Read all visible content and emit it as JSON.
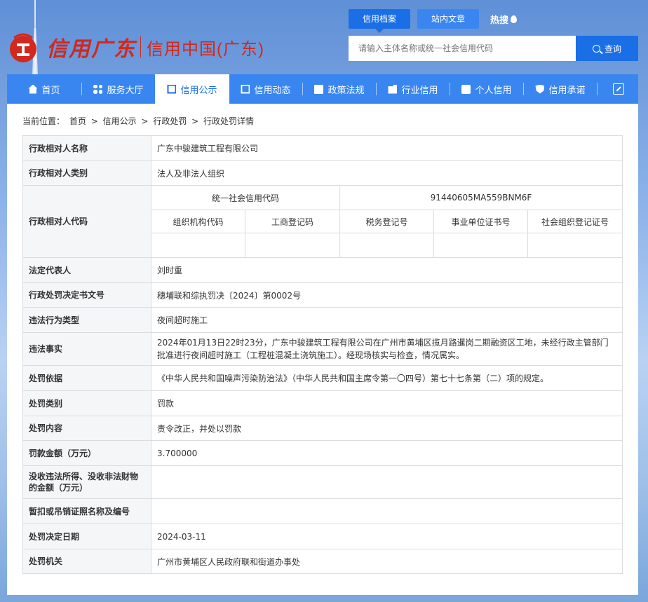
{
  "header": {
    "logo_text": "信用广东",
    "logo_sub": "信用中国(广东)",
    "search_tabs": [
      "信用档案",
      "站内文章"
    ],
    "hot_label": "热搜",
    "search_placeholder": "请输入主体名称或统一社会信用代码",
    "search_button": "查询"
  },
  "nav": {
    "items": [
      "首页",
      "服务大厅",
      "信用公示",
      "信用动态",
      "政策法规",
      "行业信用",
      "个人信用",
      "信用承诺"
    ],
    "active": "信用公示"
  },
  "breadcrumb": {
    "label": "当前位置：",
    "items": [
      "首页",
      "信用公示",
      "行政处罚",
      "行政处罚详情"
    ],
    "sep": ">"
  },
  "record": {
    "name_label": "行政相对人名称",
    "name_value": "广东中骏建筑工程有限公司",
    "type_label": "行政相对人类别",
    "type_value": "法人及非法人组织",
    "code_label": "行政相对人代码",
    "uscc_label": "统一社会信用代码",
    "uscc_value": "91440605MA559BNM6F",
    "code_headers": [
      "组织机构代码",
      "工商登记码",
      "税务登记号",
      "事业单位证书号",
      "社会组织登记证号"
    ],
    "code_values": [
      "",
      "",
      "",
      "",
      ""
    ],
    "legal_rep_label": "法定代表人",
    "legal_rep_value": "刘时重",
    "doc_no_label": "行政处罚决定书文号",
    "doc_no_value": "穗埔联和综执罚决〔2024〕第0002号",
    "violation_type_label": "违法行为类型",
    "violation_type_value": "夜间超时施工",
    "facts_label": "违法事实",
    "facts_value": "2024年01月13日22时23分，广东中骏建筑工程有限公司在广州市黄埔区揽月路暹岗二期融资区工地，未经行政主管部门批准进行夜间超时施工（工程桩混凝土浇筑施工）。经现场核实与检查，情况属实。",
    "basis_label": "处罚依据",
    "basis_value": "《中华人民共和国噪声污染防治法》（中华人民共和国主席令第一〇四号）第七十七条第（二）项的规定。",
    "category_label": "处罚类别",
    "category_value": "罚款",
    "content_label": "处罚内容",
    "content_value": "责令改正，并处以罚款",
    "amount_label": "罚款金额（万元）",
    "amount_value": "3.700000",
    "confiscation_label": "没收违法所得、没收非法财物的金额（万元）",
    "confiscation_value": "",
    "license_label": "暂扣或吊销证照名称及编号",
    "license_value": "",
    "date_label": "处罚决定日期",
    "date_value": "2024-03-11",
    "authority_label": "处罚机关",
    "authority_value": "广州市黄埔区人民政府联和街道办事处"
  }
}
